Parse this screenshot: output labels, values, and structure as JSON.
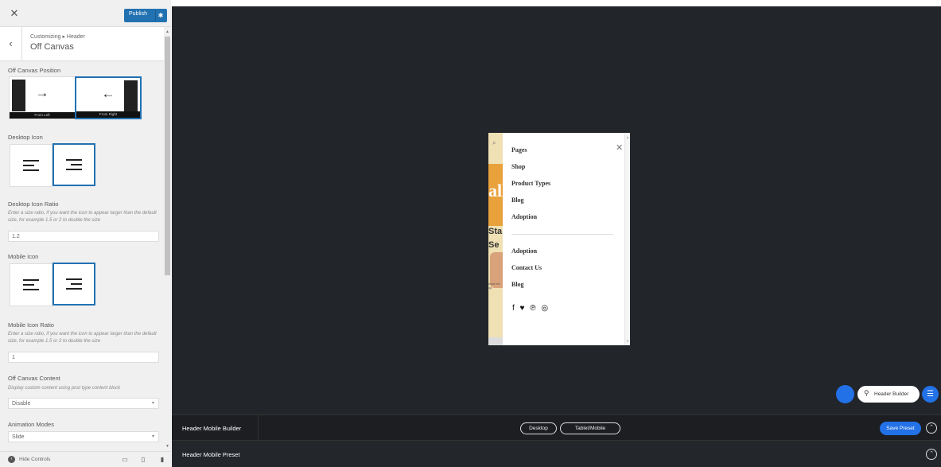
{
  "topbar": {
    "close_icon": "close-icon",
    "publish_label": "Publish",
    "gear_icon": "gear-icon"
  },
  "breadcrumb": {
    "path": "Customizing ▸ Header",
    "title": "Off Canvas"
  },
  "sections": {
    "off_canvas_position": {
      "title": "Off Canvas Position",
      "options": [
        {
          "label": "From Left",
          "arrow": "→",
          "selected": false
        },
        {
          "label": "From Right",
          "arrow": "←",
          "selected": true
        }
      ]
    },
    "desktop_icon": {
      "title": "Desktop Icon",
      "selected_index": 1
    },
    "desktop_icon_ratio": {
      "title": "Desktop Icon Ratio",
      "description": "Enter a size ratio, if you want the icon to appear larger than the default size, for example 1.5 or 2 to double the size",
      "value": "1.2"
    },
    "mobile_icon": {
      "title": "Mobile Icon",
      "selected_index": 1
    },
    "mobile_icon_ratio": {
      "title": "Mobile Icon Ratio",
      "description": "Enter a size ratio, if you want the icon to appear larger than the default size, for example 1.5 or 2 to double the size",
      "value": "1"
    },
    "off_canvas_content": {
      "title": "Off Canvas Content",
      "description": "Display custom content using post type content block",
      "value": "Disable"
    },
    "animation_modes": {
      "title": "Animation Modes",
      "value": "Slide"
    }
  },
  "footer": {
    "hide_controls_label": "Hide Controls",
    "devices": [
      "desktop-icon",
      "tablet-icon",
      "mobile-icon"
    ]
  },
  "preview": {
    "strip": {
      "big_text": "all",
      "line1": "Sta",
      "line2": "Se",
      "tiny_text": "rcbuz\nerit ug"
    },
    "menu_primary": [
      "Pages",
      "Shop",
      "Product Types",
      "Blog",
      "Adoption"
    ],
    "menu_secondary": [
      "Adoption",
      "Contact Us",
      "Blog"
    ],
    "socials": "f ♥ ℗ ◎",
    "header_builder_label": "Header Builder"
  },
  "builder": {
    "mobile_builder_title": "Header Mobile Builder",
    "tabs": [
      "Desktop",
      "Tablet/Mobile"
    ],
    "save_preset_label": "Save Preset",
    "mobile_preset_title": "Header Mobile Preset"
  },
  "colors": {
    "accent": "#2271b1",
    "preview_bg": "#22252a",
    "blue_button": "#2271e6"
  }
}
